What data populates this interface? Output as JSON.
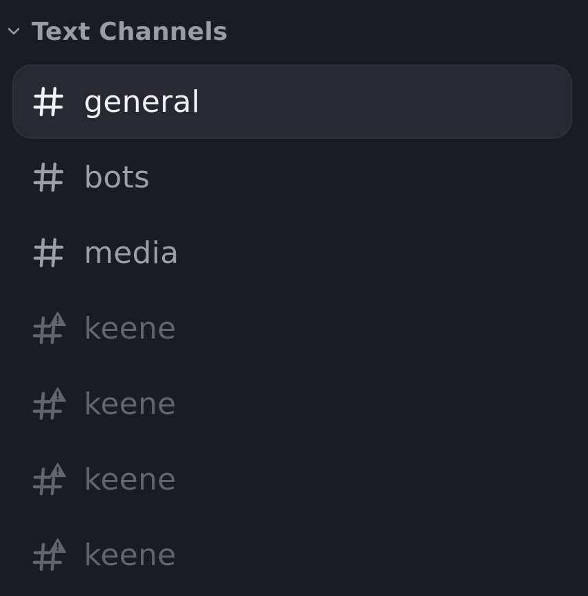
{
  "category": {
    "label": "Text Channels",
    "icon": "chevron-down-icon",
    "expanded": true
  },
  "channels": [
    {
      "name": "general",
      "icon": "hash-icon",
      "selected": true,
      "restricted": false
    },
    {
      "name": "bots",
      "icon": "hash-icon",
      "selected": false,
      "restricted": false
    },
    {
      "name": "media",
      "icon": "hash-icon",
      "selected": false,
      "restricted": false
    },
    {
      "name": "keene",
      "icon": "hash-warning-icon",
      "selected": false,
      "restricted": true
    },
    {
      "name": "keene",
      "icon": "hash-warning-icon",
      "selected": false,
      "restricted": true
    },
    {
      "name": "keene",
      "icon": "hash-warning-icon",
      "selected": false,
      "restricted": true
    },
    {
      "name": "keene",
      "icon": "hash-warning-icon",
      "selected": false,
      "restricted": true
    }
  ],
  "colors": {
    "background": "#1b1c22",
    "selected_background": "#272831",
    "selected_text": "#f1f2f5",
    "normal_text": "#9c9ea9",
    "muted_text": "#62646e",
    "category_text": "#9a9ca8"
  }
}
